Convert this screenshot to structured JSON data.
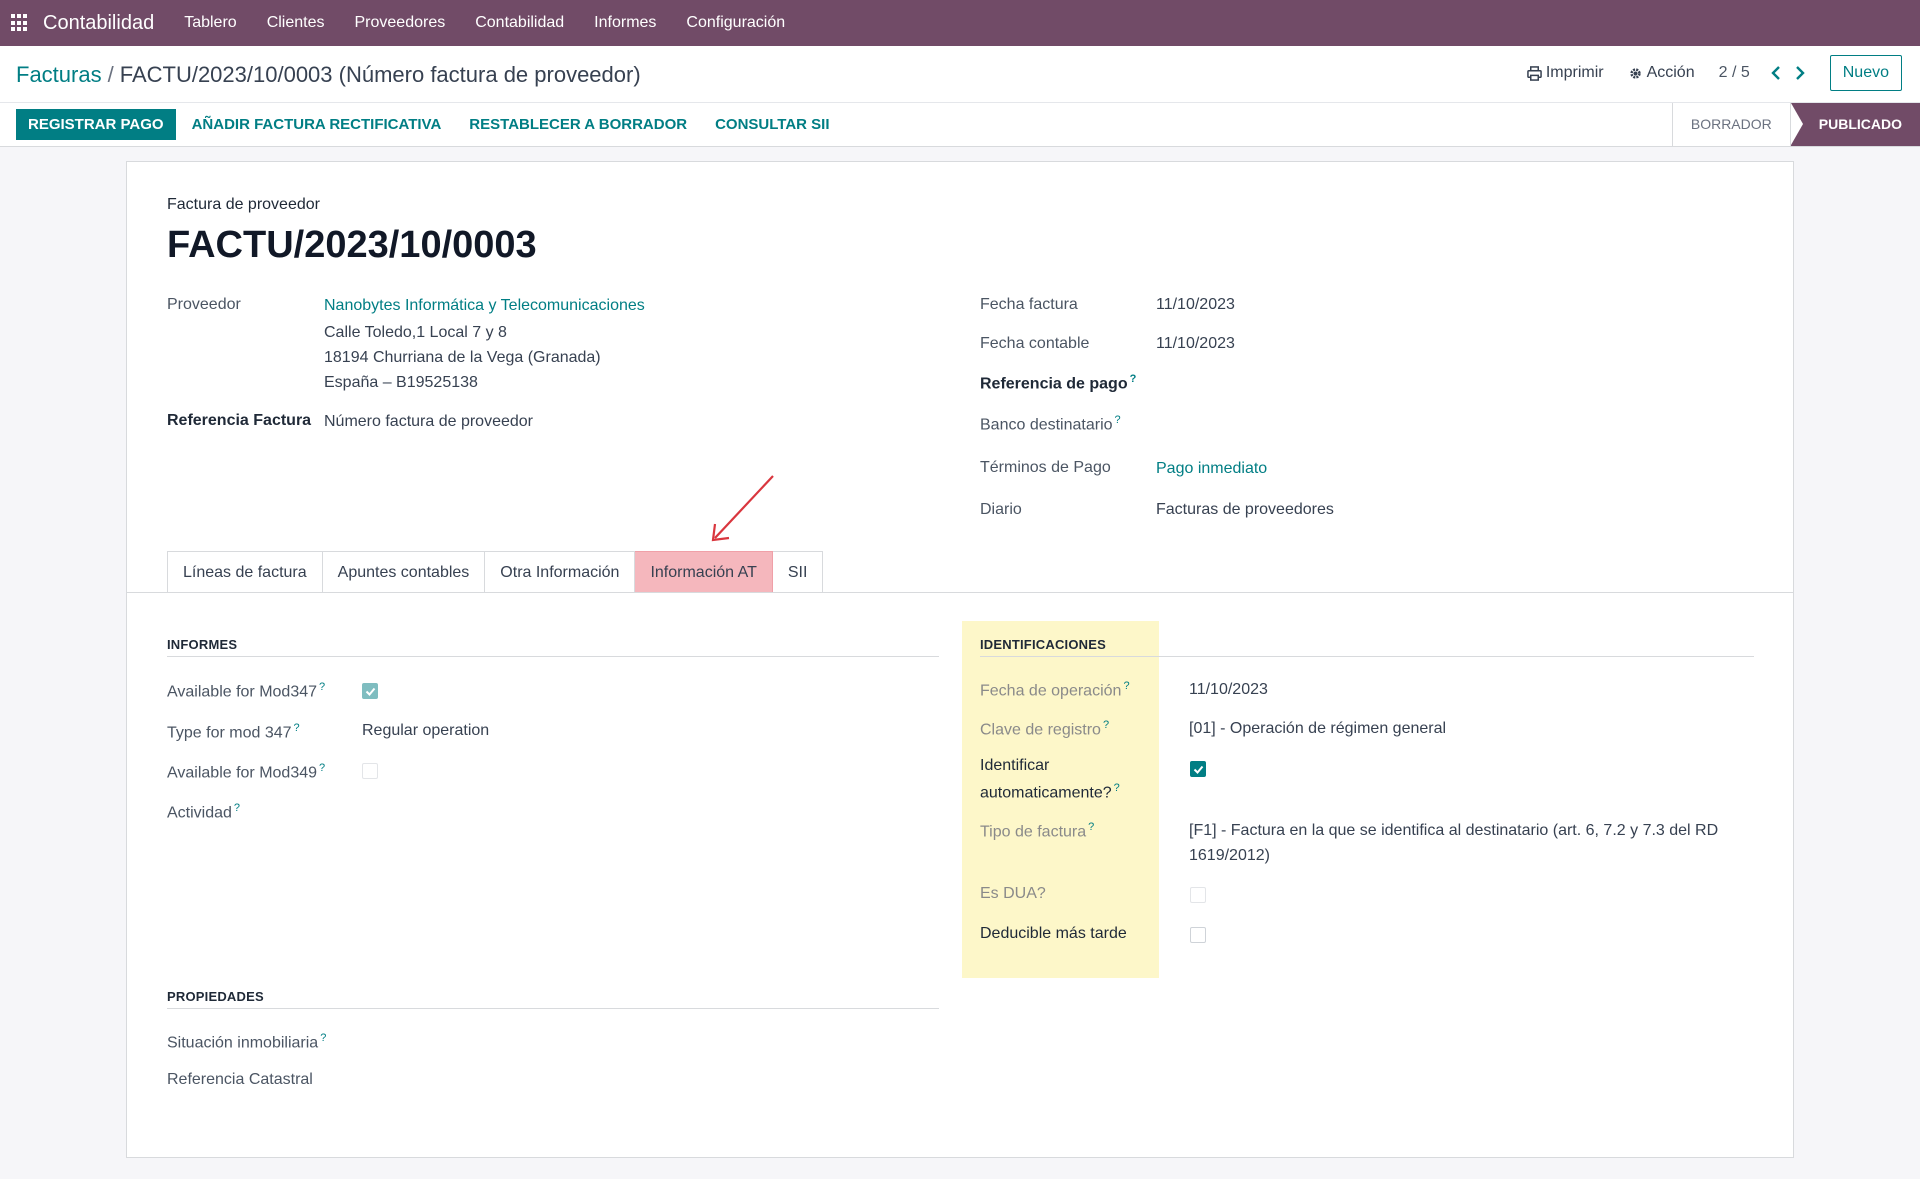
{
  "navbar": {
    "app_name": "Contabilidad",
    "menu": [
      "Tablero",
      "Clientes",
      "Proveedores",
      "Contabilidad",
      "Informes",
      "Configuración"
    ]
  },
  "control_panel": {
    "breadcrumb_parent": "Facturas",
    "breadcrumb_sep": "/",
    "breadcrumb_current": "FACTU/2023/10/0003 (Número factura de proveedor)",
    "print_label": "Imprimir",
    "action_label": "Acción",
    "pager": "2 / 5",
    "new_label": "Nuevo"
  },
  "statusbar": {
    "register_payment": "REGISTRAR PAGO",
    "add_credit_note": "AÑADIR FACTURA RECTIFICATIVA",
    "reset_draft": "RESTABLECER A BORRADOR",
    "consult_sii": "CONSULTAR SII",
    "states": [
      "BORRADOR",
      "PUBLICADO"
    ],
    "active_state": "PUBLICADO"
  },
  "invoice": {
    "type_label": "Factura de proveedor",
    "number": "FACTU/2023/10/0003",
    "vendor_label": "Proveedor",
    "vendor_name": "Nanobytes Informática y Telecomunicaciones",
    "vendor_address_1": "Calle Toledo,1 Local 7 y 8",
    "vendor_address_2": "18194 Churriana de la Vega (Granada)",
    "vendor_address_3": "España – B19525138",
    "ref_label": "Referencia Factura",
    "ref_value": "Número factura de proveedor",
    "invoice_date_label": "Fecha factura",
    "invoice_date": "11/10/2023",
    "accounting_date_label": "Fecha contable",
    "accounting_date": "11/10/2023",
    "payment_ref_label": "Referencia de pago",
    "bank_label": "Banco destinatario",
    "payment_terms_label": "Términos de Pago",
    "payment_terms": "Pago inmediato",
    "journal_label": "Diario",
    "journal": "Facturas de proveedores",
    "help_mark": "?"
  },
  "tabs": [
    "Líneas de factura",
    "Apuntes contables",
    "Otra Información",
    "Información AT",
    "SII"
  ],
  "active_tab": "Información AT",
  "informes": {
    "title": "INFORMES",
    "mod347_label": "Available for Mod347",
    "mod347_checked": true,
    "type347_label": "Type for mod 347",
    "type347_value": "Regular operation",
    "mod349_label": "Available for Mod349",
    "mod349_checked": false,
    "actividad_label": "Actividad"
  },
  "propiedades": {
    "title": "PROPIEDADES",
    "situacion_label": "Situación inmobiliaria",
    "catastral_label": "Referencia Catastral"
  },
  "identificaciones": {
    "title": "IDENTIFICACIONES",
    "fecha_op_label": "Fecha de operación",
    "fecha_op": "11/10/2023",
    "clave_label": "Clave de registro",
    "clave": "[01] - Operación de régimen general",
    "auto_label_1": "Identificar",
    "auto_label_2": "automaticamente?",
    "auto_checked": true,
    "tipo_label": "Tipo de factura",
    "tipo_1": "[F1] - Factura en la que se identifica al destinatario (art. 6, 7.2 y 7.3 del RD",
    "tipo_2": "1619/2012)",
    "dua_label": "Es DUA?",
    "dua_checked": false,
    "deducible_label": "Deducible más tarde",
    "deducible_checked": false
  },
  "colors": {
    "navbar": "#714b67",
    "accent": "#017e84",
    "tab_highlight": "#f5b7bd",
    "section_highlight": "#fdf7c9",
    "annotation_arrow": "#d9363e"
  }
}
